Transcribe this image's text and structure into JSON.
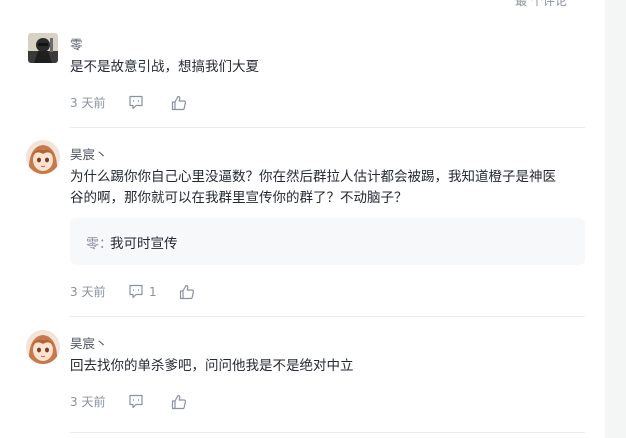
{
  "header": {
    "partial_label": "最 个评论"
  },
  "comments": [
    {
      "author": "零",
      "text": "是不是故意引战，想搞我们大夏",
      "time": "3 天前",
      "reply_count": "",
      "avatar_icon": "masked-character-avatar"
    },
    {
      "author": "昊宸丶",
      "text_line1": "为什么踢你你自己心里没逼数？你在然后群拉人估计都会被踢，我知道橙子是神医",
      "text_line2": "谷的啊，那你就可以在我群里宣传你的群了？不动脑子？",
      "time": "3 天前",
      "reply_count": "1",
      "avatar_icon": "anime-girl-avatar",
      "reply": {
        "author": "零：",
        "text": "我可时宣传"
      }
    },
    {
      "author": "昊宸丶",
      "text": "回去找你的单杀爹吧，问问他我是不是绝对中立",
      "time": "3 天前",
      "reply_count": "",
      "avatar_icon": "anime-girl-avatar"
    }
  ],
  "colors": {
    "text": "#252933",
    "muted": "#8a919f",
    "background": "#f4f5f5",
    "card": "#ffffff",
    "reply_bg": "#f7f8fa"
  }
}
